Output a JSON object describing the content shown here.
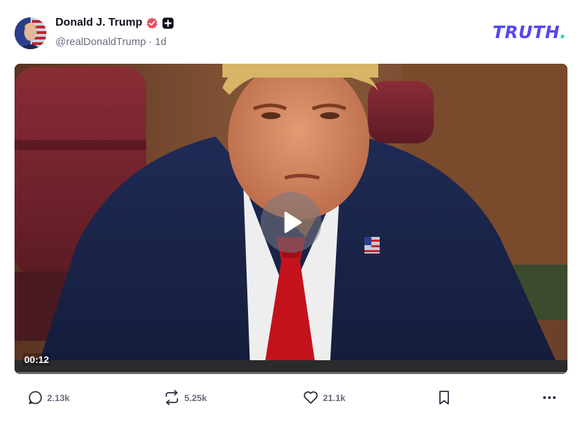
{
  "post": {
    "author": {
      "display_name": "Donald J. Trump",
      "handle": "@realDonaldTrump",
      "separator": "·",
      "time_ago": "1d"
    },
    "brand": {
      "logo_text": "TRUTH",
      "logo_dot": ".",
      "color": "#5448ee",
      "dot_color": "#22d3b8"
    },
    "video": {
      "duration_label": "00:12"
    },
    "actions": {
      "replies": "2.13k",
      "retruths": "5.25k",
      "likes": "21.1k"
    }
  },
  "icons": {
    "verified": "verified-badge-icon",
    "plus": "plus-badge-icon",
    "play": "play-icon",
    "reply": "comment-bubble-icon",
    "retruth": "repost-arrows-icon",
    "like": "heart-icon",
    "bookmark": "bookmark-icon",
    "more": "ellipsis-icon"
  }
}
